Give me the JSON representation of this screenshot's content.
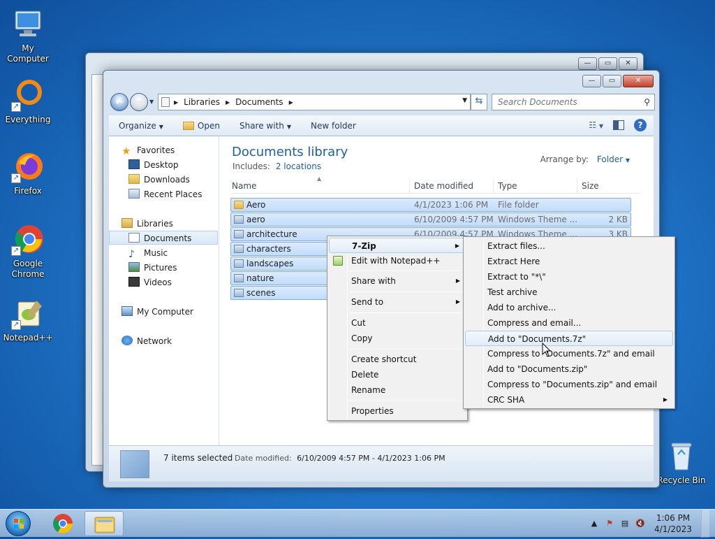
{
  "desktop": {
    "icons": [
      {
        "label": "My Computer"
      },
      {
        "label": "Everything"
      },
      {
        "label": "Firefox"
      },
      {
        "label": "Google Chrome"
      },
      {
        "label": "Notepad++"
      },
      {
        "label": "Recycle Bin"
      }
    ]
  },
  "explorer": {
    "breadcrumb": [
      "Libraries",
      "Documents"
    ],
    "search_placeholder": "Search Documents",
    "toolbar": {
      "organize": "Organize",
      "open": "Open",
      "share_with": "Share with",
      "new_folder": "New folder"
    },
    "nav": {
      "favorites": "Favorites",
      "favorites_items": [
        "Desktop",
        "Downloads",
        "Recent Places"
      ],
      "libraries": "Libraries",
      "libraries_items": [
        "Documents",
        "Music",
        "Pictures",
        "Videos"
      ],
      "my_computer": "My Computer",
      "network": "Network"
    },
    "library_title": "Documents library",
    "includes_label": "Includes:",
    "includes_link": "2 locations",
    "arrange_label": "Arrange by:",
    "arrange_value": "Folder",
    "columns": {
      "name": "Name",
      "date": "Date modified",
      "type": "Type",
      "size": "Size"
    },
    "files": [
      {
        "name": "Aero",
        "date": "4/1/2023 1:06 PM",
        "type": "File folder",
        "size": "",
        "kind": "folder"
      },
      {
        "name": "aero",
        "date": "6/10/2009 4:57 PM",
        "type": "Windows Theme ...",
        "size": "2 KB",
        "kind": "theme"
      },
      {
        "name": "architecture",
        "date": "6/10/2009 4:57 PM",
        "type": "Windows Theme ...",
        "size": "3 KB",
        "kind": "theme"
      },
      {
        "name": "characters",
        "date": "",
        "type": "",
        "size": "",
        "kind": "theme"
      },
      {
        "name": "landscapes",
        "date": "",
        "type": "",
        "size": "",
        "kind": "theme"
      },
      {
        "name": "nature",
        "date": "",
        "type": "",
        "size": "",
        "kind": "theme"
      },
      {
        "name": "scenes",
        "date": "",
        "type": "",
        "size": "",
        "kind": "theme"
      }
    ],
    "status": {
      "count": "7 items selected",
      "date_label": "Date modified:",
      "date_value": "6/10/2009 4:57 PM - 4/1/2023 1:06 PM"
    }
  },
  "context_menu": {
    "items": [
      "7-Zip",
      "Edit with Notepad++",
      "Share with",
      "Send to",
      "Cut",
      "Copy",
      "Create shortcut",
      "Delete",
      "Rename",
      "Properties"
    ]
  },
  "zip_menu": {
    "items": [
      "Extract files...",
      "Extract Here",
      "Extract to \"*\\\"",
      "Test archive",
      "Add to archive...",
      "Compress and email...",
      "Add to \"Documents.7z\"",
      "Compress to \"Documents.7z\" and email",
      "Add to \"Documents.zip\"",
      "Compress to \"Documents.zip\" and email",
      "CRC SHA"
    ],
    "highlighted": "Add to \"Documents.7z\""
  },
  "taskbar": {
    "time": "1:06 PM",
    "date": "4/1/2023"
  },
  "colors": {
    "accent": "#1e5f9e",
    "selection": "#c1dcfc"
  }
}
